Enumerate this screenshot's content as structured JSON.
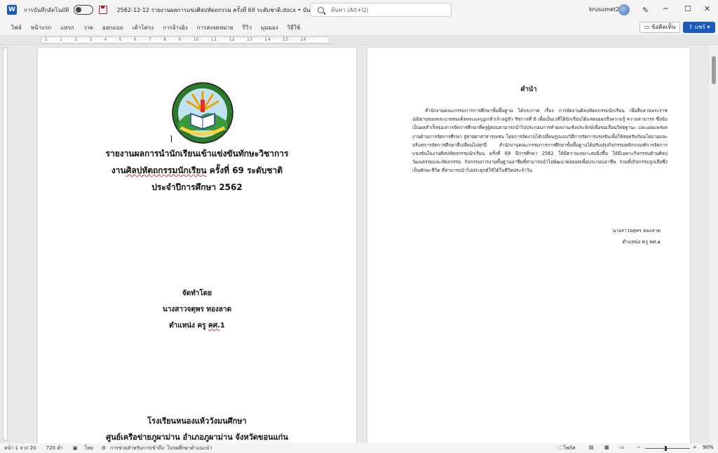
{
  "titlebar": {
    "autosave_label": "การบันทึกอัตโนมัติ",
    "doc_title": "2562-12-12 รายงานผลการแข่งศิลปหัตถกรรม ครั้งที่ 69 ระดับชาติ.docx • บันทึกไปยัง พีซีนี้",
    "search_placeholder": "ค้นหา (Alt+Q)",
    "username": "krusumet2"
  },
  "ribbon": {
    "tabs": [
      "ไฟล์",
      "หน้าแรก",
      "แทรก",
      "วาด",
      "ออกแบบ",
      "เค้าโครง",
      "การอ้างอิง",
      "การส่งจดหมาย",
      "รีวิว",
      "มุมมอง",
      "วิธีใช้"
    ],
    "comments_label": "ข้อคิดเห็น",
    "share_label": "แชร์"
  },
  "ruler": {
    "text": "· 1 · · · 1 · · · 2 · · · 3 · · · 4 · · · 5 · · · 6 · · · 7 · · · 8 · · · 9 · · · 10 · · · 11 · · · 12 · · · 13 · · · 14 · · · 15 · · · 16 · · ·"
  },
  "page1": {
    "title_line1": "รายงานผลการนำนักเรียนเข้าแข่งขันทักษะวิชาการ",
    "title_line2_a": "งาน",
    "title_line2_spell": "ศิลปหัตถกรรมนักเรียน",
    "title_line2_b": " ครั้งที่ 69 ระดับชาติ",
    "title_line3": "ประจำปีการศึกษา 2562",
    "made_by": "จัดทำโดย",
    "author": "นางสาวจตุพร ทองลาด",
    "position_a": "ตำแหน่ง ครู ",
    "position_spell": "คศ.",
    "position_b": "1",
    "school": "โรงเรียนหนองแห้ววังมนศึกษา",
    "network": "ศูนย์เครือข่ายภูผาม่าน อำเภอภูผาม่าน จังหวัดขอนแก่น"
  },
  "page2": {
    "heading": "คำนำ",
    "body": "สำนักงานคณะกรรมการการศึกษาขั้นพื้นฐาน ได้ประกาศ เรื่อง การจัดงานศิลปหัตถกรรมนักเรียน เพื่อสืบสานพระราชปณิธานของพระบาทสมเด็จพระมงกุฎเกล้าเจ้าอยู่หัว รัชกาลที่ 6 เพื่อเป็นเวทีให้นักเรียนได้แสดงออกถึงความรู้ ความสามารถ ซึ่งนับเป็นผลสำเร็จของการจัดการศึกษาที่ครูผู้สอนสามารถนำไปประกอบการทำผลงานเชิงประจักษ์เพื่อขอเลื่อนวิทยฐานะ และเผยแพร่ผลงานด้านการจัดการศึกษา สู่สายตาสาธารณชน โดยการจัดงานได้เปลี่ยนรูปแบบวิธีการจัดการแข่งขันเพื่อให้สอดรับกับนโยบายและบริบทการจัดการศึกษาที่เปลี่ยนไปทุกปี สำนักงานคณะกรรมการการศึกษาขั้นพื้นฐานได้ปรับปรุงกิจกรรมหลักเกณฑ์การจัดการแข่งขันในงานศิลปหัตถกรรมนักเรียน ครั้งที่ 69 ปีการศึกษา 2562 ให้มีความเหมาะสมยิ่งขึ้น ให้มีเฉพาะกิจกรรมด้านศิลปวัฒนธรรมและหัตถกรรม กิจกรรมการงานพื้นฐานอาชีพที่สามารถนำไปพัฒนาต่อยอดเพื่อประกอบอาชีพ รวมทั้งกิจกรรมลูกเสือซึ่งเป็นทักษะชีวิต ที่สามารถนำไปประยุกต์ใช้ได้ในชีวิตประจำวัน",
    "sign_name": "นางสาวจตุพร ทองลาด",
    "sign_position": "ตำแหน่ง ครู คศ.๑"
  },
  "statusbar": {
    "page": "หน้า 1 จาก 20",
    "words": "720 คำ",
    "language": "ไทย",
    "accessibility": "การช่วยสำหรับการเข้าถึง: โปรดศึกษาคำแนะนำ",
    "focus": "โฟกัส",
    "zoom": "90%"
  },
  "colors": {
    "accent": "#185abd",
    "spell_underline": "#d13438"
  }
}
